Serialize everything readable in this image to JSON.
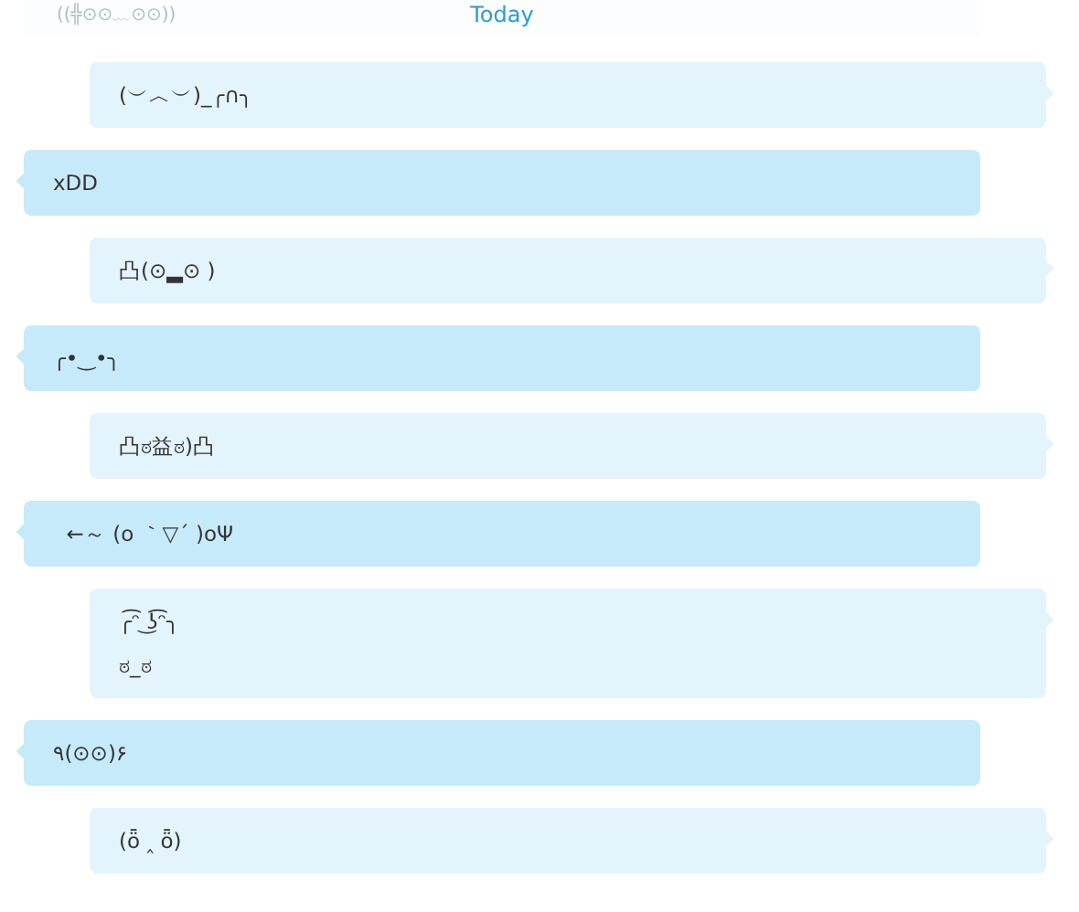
{
  "previous_message": {
    "text": "((╬⊙⊙﹏⊙⊙))"
  },
  "date_divider": {
    "label": "Today"
  },
  "messages": [
    {
      "kind": "sent",
      "lines": [
        "(︶︿︶)_╭∩╮"
      ]
    },
    {
      "kind": "received",
      "lines": [
        "xDD"
      ]
    },
    {
      "kind": "sent",
      "lines": [
        "凸(⊙▂⊙ )"
      ]
    },
    {
      "kind": "received",
      "lines": [
        "╭•‿•╮"
      ]
    },
    {
      "kind": "sent",
      "lines": [
        "凸ಠ益ಠ)凸"
      ]
    },
    {
      "kind": "received",
      "lines": [
        "  ←～ (o ｀▽´ )oΨ"
      ]
    },
    {
      "kind": "sent",
      "lines": [
        "╭͡ᵔ ͜ʖ͡ᵔ╮",
        "ಠ_ಠ"
      ]
    },
    {
      "kind": "received",
      "lines": [
        "٩(⊙⊙)۶"
      ]
    },
    {
      "kind": "sent",
      "lines": [
        "(ȫ ‸ ȫ)"
      ]
    }
  ]
}
